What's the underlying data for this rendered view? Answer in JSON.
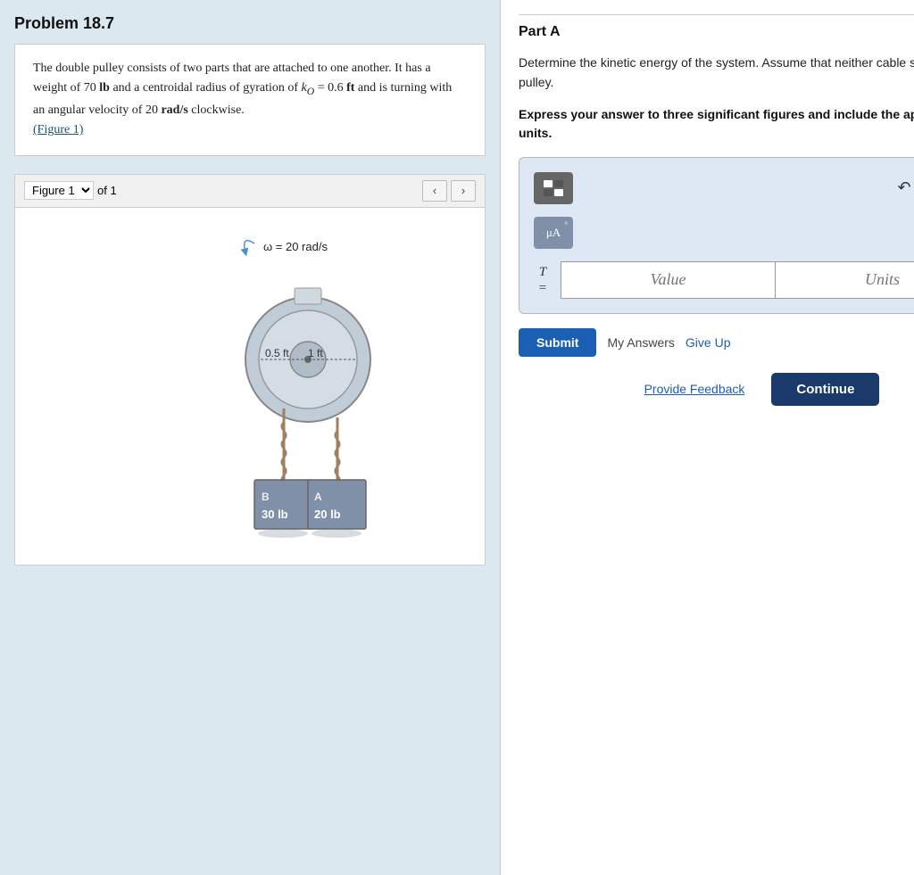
{
  "problem": {
    "title": "Problem 18.7",
    "statement_parts": [
      "The double pulley consists of two parts that are attached to one another. It has a weight of 70 lb and a centroidal radius of gyration of k",
      "O",
      " = 0.6 ft and is turning with an angular velocity of 20 rad/s clockwise."
    ],
    "figure_link_text": "(Figure 1)",
    "figure_label": "Figure 1",
    "figure_of": "of 1"
  },
  "part": {
    "title": "Part A",
    "description": "Determine the kinetic energy of the system. Assume that neither cable slips on the pulley.",
    "instruction": "Express your answer to three significant figures and include the appropriate units.",
    "value_placeholder": "Value",
    "units_placeholder": "Units",
    "submit_label": "Submit",
    "my_answers_label": "My Answers",
    "give_up_label": "Give Up",
    "provide_feedback_label": "Provide Feedback",
    "continue_label": "Continue"
  },
  "figure": {
    "omega_label": "ω = 20 rad/s",
    "radius1": "0.5 ft",
    "radius2": "1 ft",
    "weight_B": "30 lb",
    "weight_A": "20 lb",
    "label_B": "B",
    "label_A": "A"
  },
  "toolbar": {
    "undo_label": "↺",
    "redo_label": "↻",
    "refresh_label": "↺",
    "mu_a_label": "μA"
  }
}
